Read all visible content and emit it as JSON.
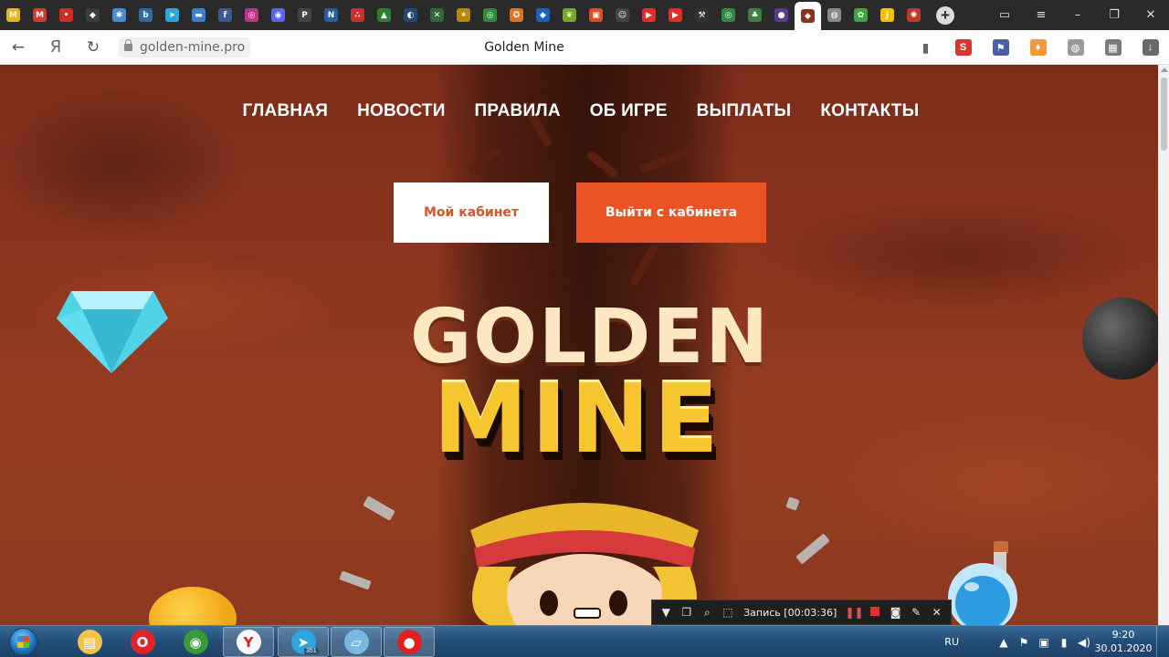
{
  "browser": {
    "tab_favicons": [
      {
        "name": "gmail-icon",
        "color": "#e8b21a",
        "glyph": "M"
      },
      {
        "name": "mail-icon",
        "color": "#d33a2c",
        "glyph": "M"
      },
      {
        "name": "red-pin-icon",
        "color": "#d52a2a",
        "glyph": "•"
      },
      {
        "name": "site-icon",
        "color": "#3d3d3d",
        "glyph": "◆"
      },
      {
        "name": "joomla-icon",
        "color": "#4c8bd4",
        "glyph": "✱"
      },
      {
        "name": "b-site-icon",
        "color": "#2d6aa8",
        "glyph": "b"
      },
      {
        "name": "telegram-icon",
        "color": "#2ca5e0",
        "glyph": "➤"
      },
      {
        "name": "chat-icon",
        "color": "#3f7fd0",
        "glyph": "▬"
      },
      {
        "name": "facebook-icon",
        "color": "#3b5998",
        "glyph": "f"
      },
      {
        "name": "instagram-icon",
        "color": "#c13584",
        "glyph": "◎"
      },
      {
        "name": "discord-icon",
        "color": "#5865f2",
        "glyph": "◉"
      },
      {
        "name": "p-site-icon",
        "color": "#444",
        "glyph": "P"
      },
      {
        "name": "n-site-icon",
        "color": "#2a5aa8",
        "glyph": "N"
      },
      {
        "name": "red-dots-icon",
        "color": "#c9302c",
        "glyph": "∴"
      },
      {
        "name": "triangle-icon",
        "color": "#2e7d32",
        "glyph": "▲"
      },
      {
        "name": "globe-site-icon",
        "color": "#1e4a7a",
        "glyph": "◐"
      },
      {
        "name": "crossed-icon",
        "color": "#2f6b3a",
        "glyph": "✕"
      },
      {
        "name": "star-icon",
        "color": "#b8860b",
        "glyph": "✶"
      },
      {
        "name": "green-circle-icon",
        "color": "#2e8b3e",
        "glyph": "◎"
      },
      {
        "name": "fox-icon",
        "color": "#d9731f",
        "glyph": "✪"
      },
      {
        "name": "shield-icon",
        "color": "#1f5fbf",
        "glyph": "◆"
      },
      {
        "name": "leaf-icon",
        "color": "#7aa52a",
        "glyph": "❦"
      },
      {
        "name": "apps-icon",
        "color": "#e04a2a",
        "glyph": "▣"
      },
      {
        "name": "face-icon",
        "color": "#444",
        "glyph": "☺"
      },
      {
        "name": "youtube-icon",
        "color": "#e52d27",
        "glyph": "▶"
      },
      {
        "name": "youtube-icon-2",
        "color": "#e52d27",
        "glyph": "▶"
      },
      {
        "name": "pick-icon",
        "color": "#333",
        "glyph": "⚒"
      },
      {
        "name": "swirl-icon",
        "color": "#2e8b3e",
        "glyph": "◎"
      },
      {
        "name": "tree-icon",
        "color": "#3f7f3f",
        "glyph": "♣"
      },
      {
        "name": "planet-icon",
        "color": "#5a3a8a",
        "glyph": "●"
      }
    ],
    "active_tab_favicon": {
      "name": "golden-mine-favicon",
      "color": "#8a3420",
      "glyph": "◆"
    },
    "more_tabs": [
      {
        "name": "ball-icon",
        "color": "#8a8a8a",
        "glyph": "◍"
      },
      {
        "name": "leaf2-icon",
        "color": "#3aa83a",
        "glyph": "✿"
      },
      {
        "name": "j-site-icon",
        "color": "#f2c200",
        "glyph": "J"
      },
      {
        "name": "gear-site-icon",
        "color": "#c0392b",
        "glyph": "✺"
      }
    ],
    "url": "golden-mine.pro",
    "page_title": "Golden Mine",
    "yandex_glyph": "Я",
    "extensions": [
      {
        "name": "extension-red-s-icon",
        "color": "#d9342b",
        "glyph": "S"
      },
      {
        "name": "extension-flag-icon",
        "color": "#4a5fa8",
        "glyph": "⚑"
      },
      {
        "name": "metamask-fox-icon",
        "color": "#f29a3a",
        "glyph": "♦"
      },
      {
        "name": "globe-icon",
        "color": "#9a9a9a",
        "glyph": "◍"
      },
      {
        "name": "puzzle-icon",
        "color": "#7a7a7a",
        "glyph": "▦"
      },
      {
        "name": "download-icon",
        "color": "#6a6a6a",
        "glyph": "↓"
      }
    ]
  },
  "site": {
    "nav": [
      "ГЛАВНАЯ",
      "НОВОСТИ",
      "ПРАВИЛА",
      "ОБ ИГРЕ",
      "ВЫПЛАТЫ",
      "КОНТАКТЫ"
    ],
    "cabinet_button": "Мой кабинет",
    "logout_button": "Выйти с кабинета",
    "logo_top": "GOLDEN",
    "logo_bottom": "MINE"
  },
  "recorder": {
    "status": "Запись [00:03:36]"
  },
  "taskbar": {
    "apps": [
      {
        "name": "explorer-app",
        "color": "#f2c34a",
        "glyph": "▤"
      },
      {
        "name": "opera-app",
        "color": "#e0242a",
        "glyph": "O"
      },
      {
        "name": "chrome-app",
        "color": "#3a9a3a",
        "glyph": "◉"
      },
      {
        "name": "yandex-browser-app",
        "color": "#ffffff",
        "glyph": "Y"
      },
      {
        "name": "telegram-app",
        "color": "#2ca5e0",
        "glyph": "➤"
      },
      {
        "name": "notepad-app",
        "color": "#7ab8e0",
        "glyph": "▱"
      },
      {
        "name": "recorder-app",
        "color": "#e02020",
        "glyph": "●"
      }
    ],
    "telegram_badge": "351",
    "language": "RU",
    "time": "9:20",
    "date": "30.01.2020"
  },
  "colors": {
    "accent_orange": "#ea5424",
    "cabinet_text": "#d5562a",
    "logo_gold": "#f7c530",
    "logo_cream": "#fde8c2"
  }
}
